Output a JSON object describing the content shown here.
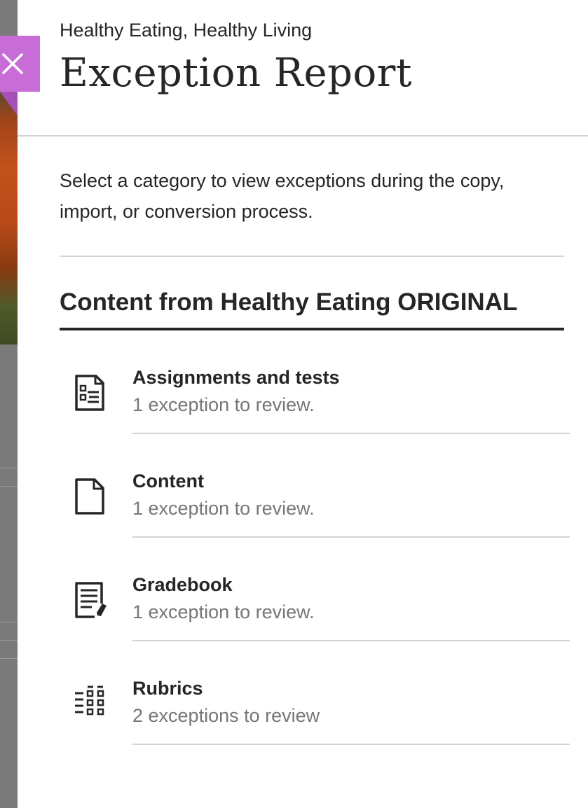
{
  "header": {
    "course_name": "Healthy Eating, Healthy Living",
    "title": "Exception Report"
  },
  "close": {
    "icon": "close-icon",
    "color": "#c86dd7"
  },
  "intro": "Select a category to view exceptions during the copy, import, or conversion process.",
  "section": {
    "title": "Content from Healthy Eating ORIGINAL"
  },
  "categories": [
    {
      "label": "Assignments and tests",
      "status": "1 exception to review.",
      "icon": "assignment-list-icon"
    },
    {
      "label": "Content",
      "status": "1 exception to review.",
      "icon": "document-icon"
    },
    {
      "label": "Gradebook",
      "status": "1 exception to review.",
      "icon": "gradebook-icon"
    },
    {
      "label": "Rubrics",
      "status": "2 exceptions to review",
      "icon": "rubric-grid-icon"
    }
  ]
}
